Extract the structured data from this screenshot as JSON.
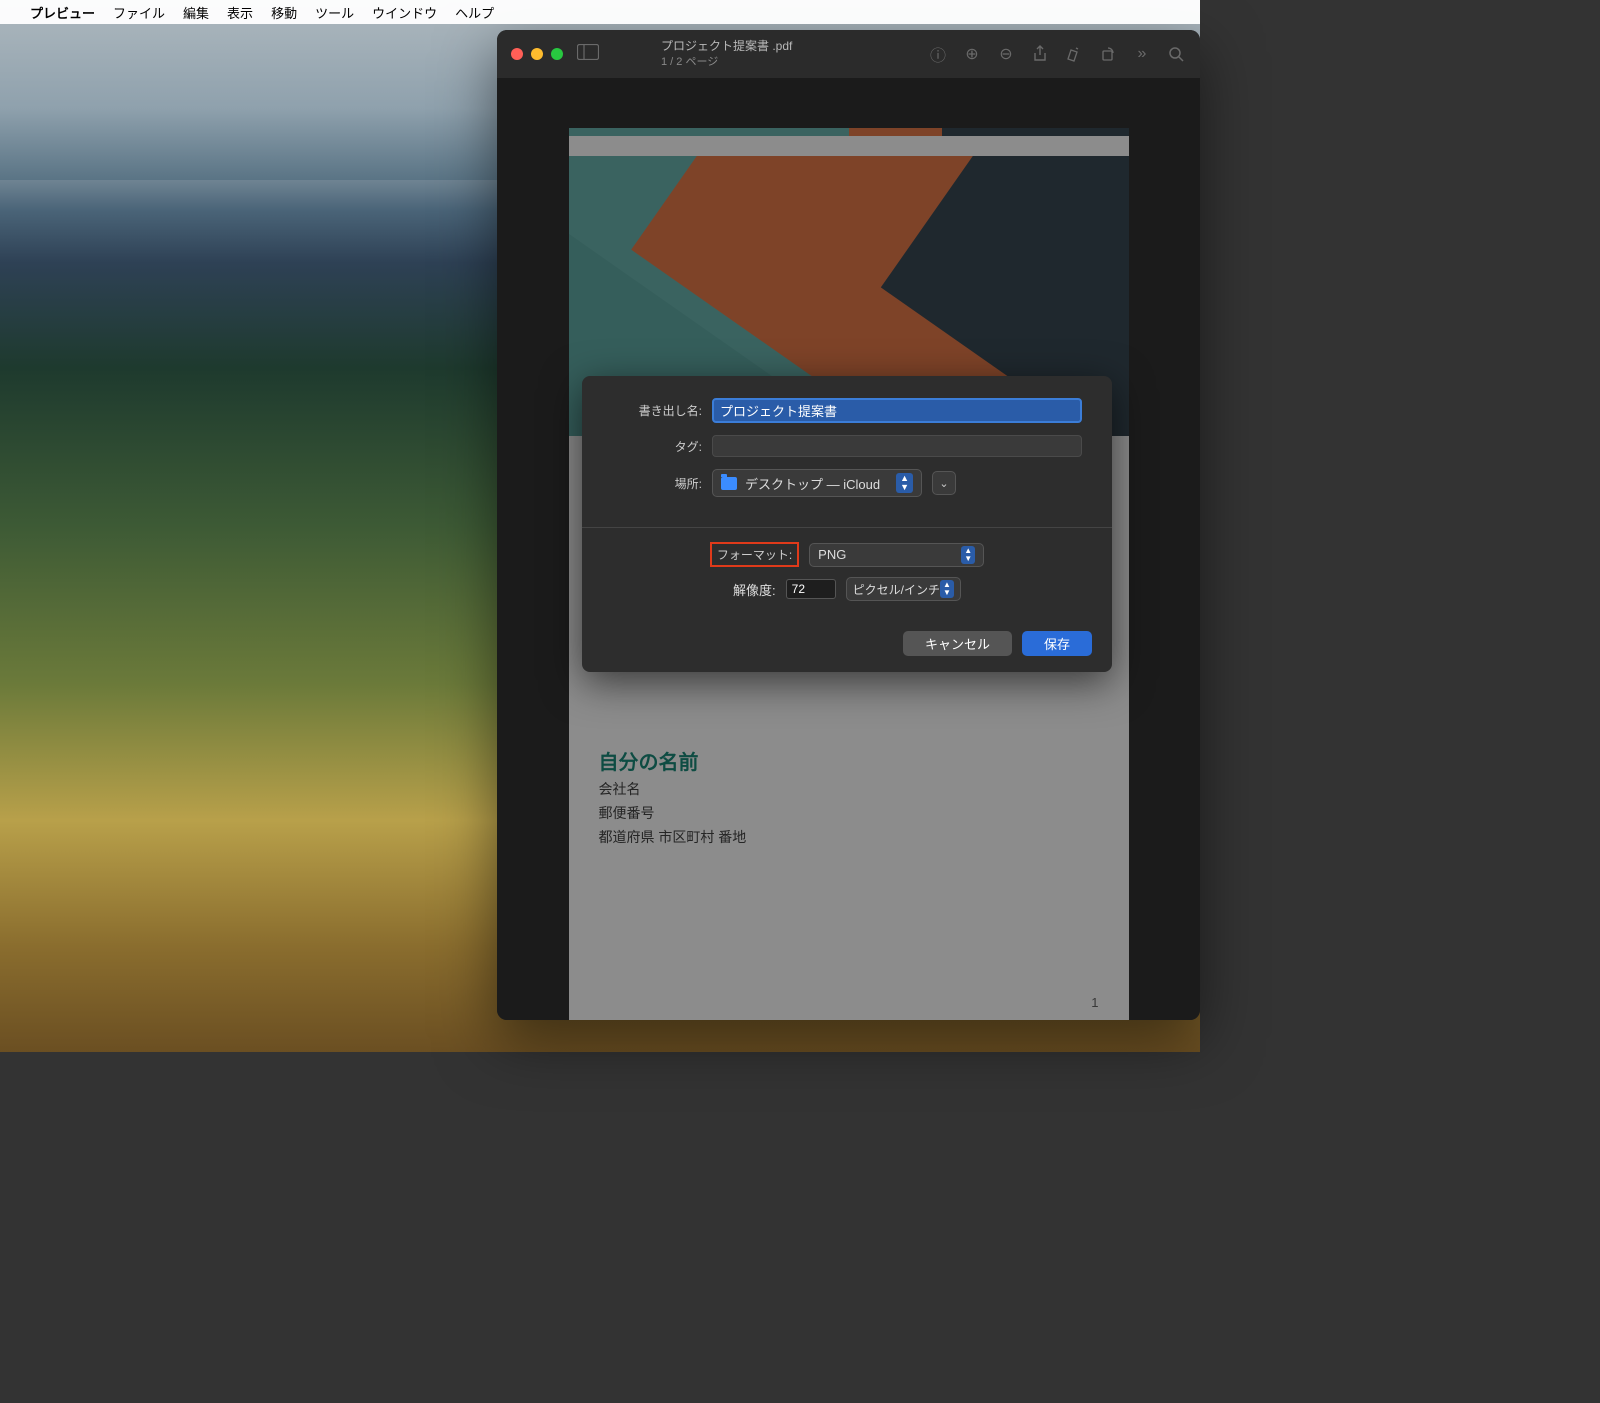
{
  "menubar": {
    "app": "プレビュー",
    "items": [
      "ファイル",
      "編集",
      "表示",
      "移動",
      "ツール",
      "ウインドウ",
      "ヘルプ"
    ]
  },
  "window": {
    "filename": "プロジェクト提案書 .pdf",
    "page_info": "1 / 2 ページ"
  },
  "document": {
    "heading": "自分の名前",
    "company": "会社名",
    "postal": "郵便番号",
    "address": "都道府県 市区町村 番地",
    "page_num": "1"
  },
  "sheet": {
    "export_name_label": "書き出し名:",
    "export_name_value": "プロジェクト提案書",
    "tag_label": "タグ:",
    "location_label": "場所:",
    "location_value": "デスクトップ — iCloud",
    "format_label": "フォーマット:",
    "format_value": "PNG",
    "resolution_label": "解像度:",
    "resolution_value": "72",
    "resolution_unit": "ピクセル/インチ",
    "cancel": "キャンセル",
    "save": "保存"
  }
}
